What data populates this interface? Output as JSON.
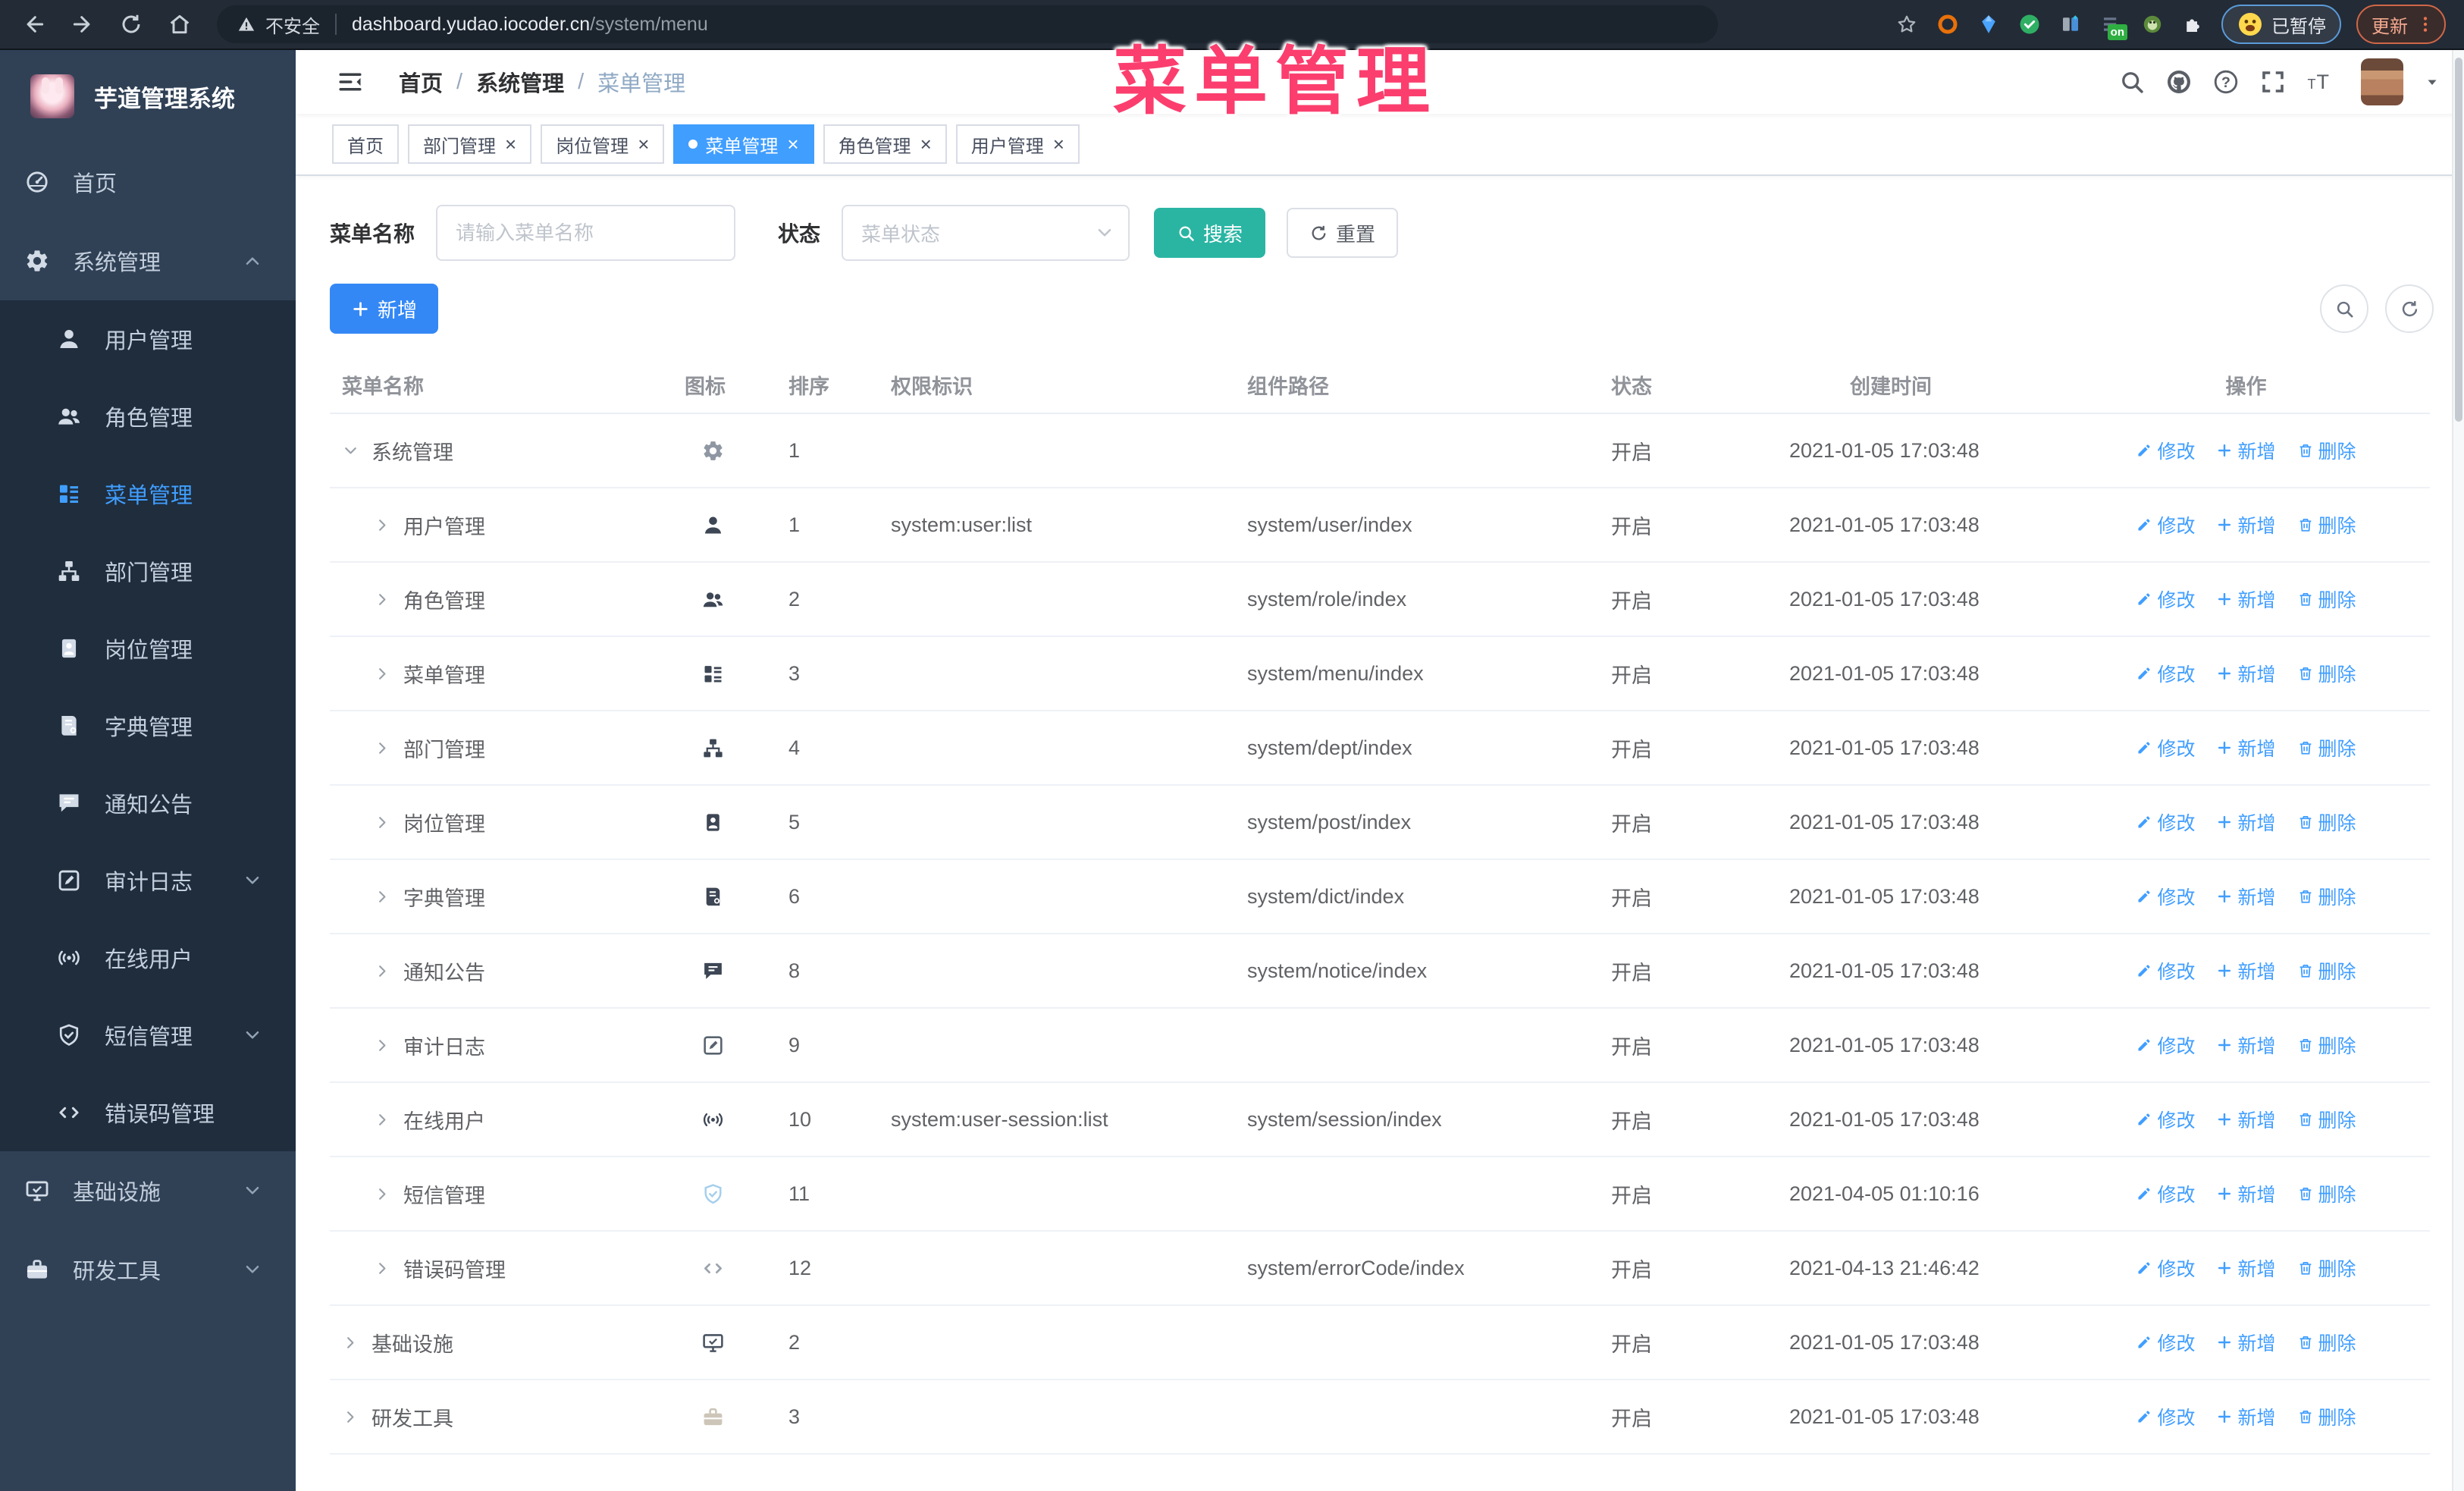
{
  "browser": {
    "security_label": "不安全",
    "url_host": "dashboard.yudao.iocoder.cn",
    "url_path": "/system/menu",
    "paused_label": "已暂停",
    "update_label": "更新"
  },
  "overlay": {
    "title": "菜单管理",
    "color": "#fb3e6e"
  },
  "sidebar": {
    "logo_title": "芋道管理系统",
    "items": [
      {
        "label": "首页",
        "icon": "dashboard",
        "level": "top",
        "active": false,
        "arrow": ""
      },
      {
        "label": "系统管理",
        "icon": "gear",
        "level": "top",
        "active": false,
        "arrow": "up"
      },
      {
        "label": "用户管理",
        "icon": "user",
        "level": "sub",
        "active": false,
        "arrow": ""
      },
      {
        "label": "角色管理",
        "icon": "users",
        "level": "sub",
        "active": false,
        "arrow": ""
      },
      {
        "label": "菜单管理",
        "icon": "menu",
        "level": "sub",
        "active": true,
        "arrow": ""
      },
      {
        "label": "部门管理",
        "icon": "tree",
        "level": "sub",
        "active": false,
        "arrow": ""
      },
      {
        "label": "岗位管理",
        "icon": "badge",
        "level": "sub",
        "active": false,
        "arrow": ""
      },
      {
        "label": "字典管理",
        "icon": "book",
        "level": "sub",
        "active": false,
        "arrow": ""
      },
      {
        "label": "通知公告",
        "icon": "message",
        "level": "sub",
        "active": false,
        "arrow": ""
      },
      {
        "label": "审计日志",
        "icon": "edit",
        "level": "sub",
        "active": false,
        "arrow": "down"
      },
      {
        "label": "在线用户",
        "icon": "online",
        "level": "sub",
        "active": false,
        "arrow": ""
      },
      {
        "label": "短信管理",
        "icon": "shield",
        "level": "sub",
        "active": false,
        "arrow": "down"
      },
      {
        "label": "错误码管理",
        "icon": "code",
        "level": "sub",
        "active": false,
        "arrow": ""
      },
      {
        "label": "基础设施",
        "icon": "monitor",
        "level": "top",
        "active": false,
        "arrow": "down"
      },
      {
        "label": "研发工具",
        "icon": "toolbox",
        "level": "top",
        "active": false,
        "arrow": "down"
      }
    ]
  },
  "header": {
    "breadcrumb": [
      "首页",
      "系统管理",
      "菜单管理"
    ]
  },
  "tabs": [
    {
      "label": "首页",
      "closable": false,
      "active": false
    },
    {
      "label": "部门管理",
      "closable": true,
      "active": false
    },
    {
      "label": "岗位管理",
      "closable": true,
      "active": false
    },
    {
      "label": "菜单管理",
      "closable": true,
      "active": true
    },
    {
      "label": "角色管理",
      "closable": true,
      "active": false
    },
    {
      "label": "用户管理",
      "closable": true,
      "active": false
    }
  ],
  "filters": {
    "name_label": "菜单名称",
    "name_placeholder": "请输入菜单名称",
    "name_value": "",
    "status_label": "状态",
    "status_placeholder": "菜单状态",
    "search_label": "搜索",
    "reset_label": "重置"
  },
  "toolbar": {
    "add_label": "新增"
  },
  "table": {
    "columns": [
      "菜单名称",
      "图标",
      "排序",
      "权限标识",
      "组件路径",
      "状态",
      "创建时间",
      "操作"
    ],
    "action_labels": {
      "edit": "修改",
      "add": "新增",
      "delete": "删除"
    },
    "rows": [
      {
        "name": "系统管理",
        "icon": "gear",
        "icon_color": "#8f97a3",
        "sort": "1",
        "perm": "",
        "path": "",
        "status": "开启",
        "time": "2021-01-05 17:03:48",
        "level": 0,
        "caret": "down"
      },
      {
        "name": "用户管理",
        "icon": "user",
        "icon_color": "#3d4654",
        "sort": "1",
        "perm": "system:user:list",
        "path": "system/user/index",
        "status": "开启",
        "time": "2021-01-05 17:03:48",
        "level": 1,
        "caret": "right"
      },
      {
        "name": "角色管理",
        "icon": "users",
        "icon_color": "#3d4654",
        "sort": "2",
        "perm": "",
        "path": "system/role/index",
        "status": "开启",
        "time": "2021-01-05 17:03:48",
        "level": 1,
        "caret": "right"
      },
      {
        "name": "菜单管理",
        "icon": "menu",
        "icon_color": "#3d4654",
        "sort": "3",
        "perm": "",
        "path": "system/menu/index",
        "status": "开启",
        "time": "2021-01-05 17:03:48",
        "level": 1,
        "caret": "right"
      },
      {
        "name": "部门管理",
        "icon": "tree",
        "icon_color": "#3d4654",
        "sort": "4",
        "perm": "",
        "path": "system/dept/index",
        "status": "开启",
        "time": "2021-01-05 17:03:48",
        "level": 1,
        "caret": "right"
      },
      {
        "name": "岗位管理",
        "icon": "badge",
        "icon_color": "#3d4654",
        "sort": "5",
        "perm": "",
        "path": "system/post/index",
        "status": "开启",
        "time": "2021-01-05 17:03:48",
        "level": 1,
        "caret": "right"
      },
      {
        "name": "字典管理",
        "icon": "book",
        "icon_color": "#3d4654",
        "sort": "6",
        "perm": "",
        "path": "system/dict/index",
        "status": "开启",
        "time": "2021-01-05 17:03:48",
        "level": 1,
        "caret": "right"
      },
      {
        "name": "通知公告",
        "icon": "message",
        "icon_color": "#3d4654",
        "sort": "8",
        "perm": "",
        "path": "system/notice/index",
        "status": "开启",
        "time": "2021-01-05 17:03:48",
        "level": 1,
        "caret": "right"
      },
      {
        "name": "审计日志",
        "icon": "edit",
        "icon_color": "#59636f",
        "sort": "9",
        "perm": "",
        "path": "",
        "status": "开启",
        "time": "2021-01-05 17:03:48",
        "level": 1,
        "caret": "right"
      },
      {
        "name": "在线用户",
        "icon": "online",
        "icon_color": "#3d4654",
        "sort": "10",
        "perm": "system:user-session:list",
        "path": "system/session/index",
        "status": "开启",
        "time": "2021-01-05 17:03:48",
        "level": 1,
        "caret": "right"
      },
      {
        "name": "短信管理",
        "icon": "shield",
        "icon_color": "#a5cfec",
        "sort": "11",
        "perm": "",
        "path": "",
        "status": "开启",
        "time": "2021-04-05 01:10:16",
        "level": 1,
        "caret": "right"
      },
      {
        "name": "错误码管理",
        "icon": "code",
        "icon_color": "#9aa3ad",
        "sort": "12",
        "perm": "",
        "path": "system/errorCode/index",
        "status": "开启",
        "time": "2021-04-13 21:46:42",
        "level": 1,
        "caret": "right"
      },
      {
        "name": "基础设施",
        "icon": "monitor",
        "icon_color": "#4a5462",
        "sort": "2",
        "perm": "",
        "path": "",
        "status": "开启",
        "time": "2021-01-05 17:03:48",
        "level": 0,
        "caret": "right"
      },
      {
        "name": "研发工具",
        "icon": "toolbox",
        "icon_color": "#cdc5b8",
        "sort": "3",
        "perm": "",
        "path": "",
        "status": "开启",
        "time": "2021-01-05 17:03:48",
        "level": 0,
        "caret": "right"
      }
    ]
  },
  "colors": {
    "primary": "#409EFF",
    "search_button": "#2ab5a3",
    "sidebar_bg": "#304156",
    "submenu_bg": "#1f2d3d"
  }
}
